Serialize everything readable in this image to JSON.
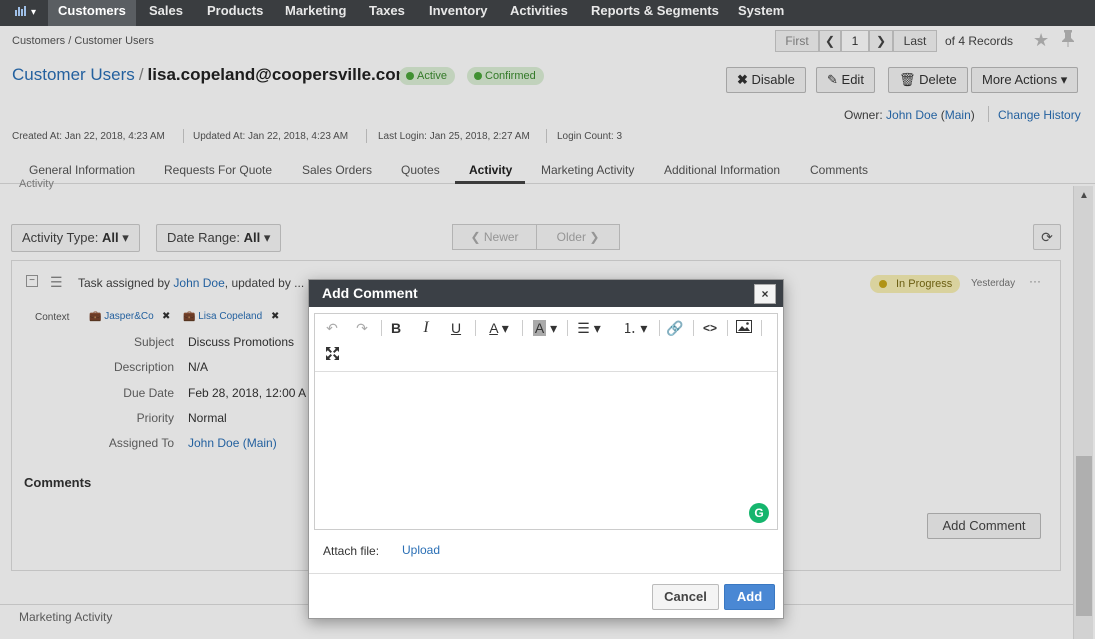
{
  "topnav": {
    "items": [
      "Customers",
      "Sales",
      "Products",
      "Marketing",
      "Taxes",
      "Inventory",
      "Activities",
      "Reports & Segments",
      "System"
    ]
  },
  "breadcrumb": {
    "parent": "Customers",
    "sep": "/",
    "current": "Customer Users"
  },
  "pager": {
    "first": "First",
    "page": "1",
    "last": "Last",
    "records": "of 4 Records"
  },
  "header": {
    "section": "Customer Users",
    "sep": "/",
    "email": "lisa.copeland@coopersville.com",
    "badges": [
      "Active",
      "Confirmed"
    ],
    "buttons": {
      "disable": "Disable",
      "edit": "Edit",
      "delete": "Delete",
      "more": "More Actions"
    },
    "owner_label": "Owner:",
    "owner": "John Doe",
    "owner_main": "Main",
    "change_history": "Change History"
  },
  "meta": {
    "created": "Created At: Jan 22, 2018, 4:23 AM",
    "updated": "Updated At: Jan 22, 2018, 4:23 AM",
    "login": "Last Login: Jan 25, 2018, 2:27 AM",
    "count": "Login Count: 3"
  },
  "tabs": [
    "General Information",
    "Requests For Quote",
    "Sales Orders",
    "Quotes",
    "Activity",
    "Marketing Activity",
    "Additional Information",
    "Comments"
  ],
  "activity": {
    "section_label": "Activity",
    "type_label": "Activity Type:",
    "type_value": "All",
    "range_label": "Date Range:",
    "range_value": "All",
    "newer": "Newer",
    "older": "Older",
    "task_prefix": "Task assigned by",
    "task_user": "John Doe",
    "task_suffix": ", updated by ...",
    "status": "In Progress",
    "time": "Yesterday",
    "context_label": "Context",
    "context": [
      "Jasper&Co",
      "Lisa Copeland"
    ],
    "fields": [
      {
        "label": "Subject",
        "value": "Discuss Promotions"
      },
      {
        "label": "Description",
        "value": "N/A"
      },
      {
        "label": "Due Date",
        "value": "Feb 28, 2018, 12:00 A"
      },
      {
        "label": "Priority",
        "value": "Normal"
      },
      {
        "label": "Assigned To",
        "value": "John Doe",
        "extra": "Main"
      }
    ],
    "comments_heading": "Comments",
    "add_comment": "Add Comment",
    "next_section": "Marketing Activity"
  },
  "dialog": {
    "title": "Add Comment",
    "close": "×",
    "attach_label": "Attach file:",
    "upload": "Upload",
    "cancel": "Cancel",
    "add": "Add"
  },
  "colors": {
    "accent": "#2a6fb5",
    "nav": "#3a3d40",
    "add": "#4a88d4"
  }
}
